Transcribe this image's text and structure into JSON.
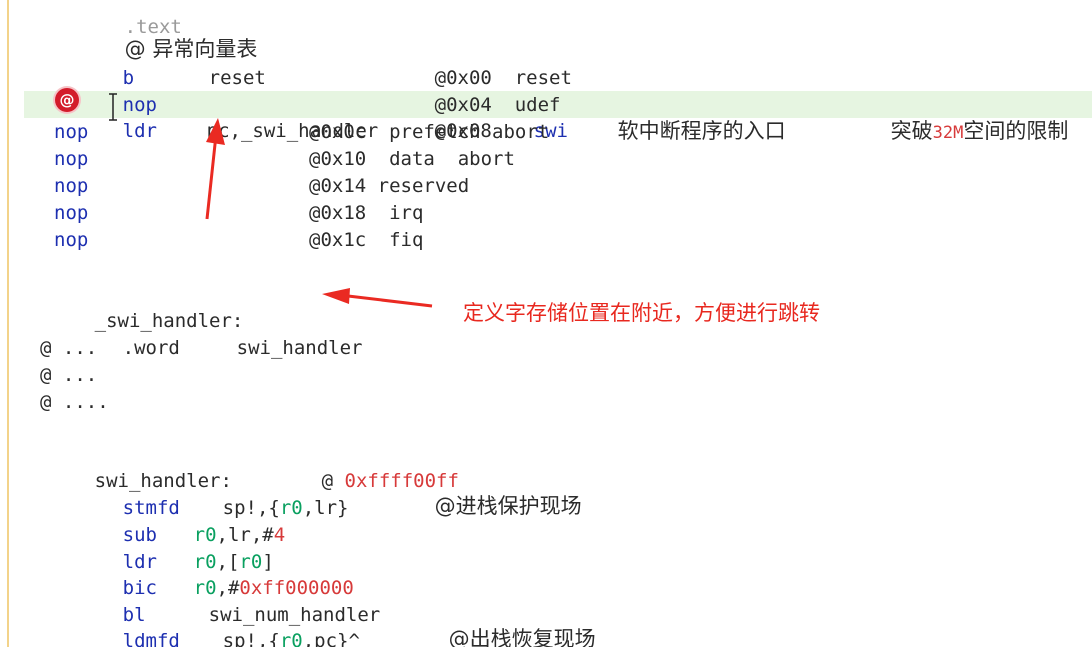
{
  "lines": {
    "text_directive": ".text",
    "vector_comment": "@ 异常向量表",
    "l_b": {
      "op": "b",
      "arg": "reset",
      "comment": "@0x00  reset"
    },
    "l_nop_udef": {
      "op": "nop",
      "comment": "@0x04  udef"
    },
    "l_ldr": {
      "op": "ldr",
      "arg": "pc,_swi_handler",
      "comment_addr": "@0x08",
      "comment_swi": "swi",
      "desc_cn": "软中断程序的入口",
      "desc_break": "突破",
      "desc_32m": "32M",
      "desc_rest": "空间的限制"
    },
    "l_nop_prefetch": {
      "op": "nop",
      "comment": "@0x0c  prefetch abort"
    },
    "l_nop_data": {
      "op": "nop",
      "comment": "@0x10  data  abort"
    },
    "l_nop_reserved": {
      "op": "nop",
      "comment": "@0x14 reserved"
    },
    "l_nop_irq": {
      "op": "nop",
      "comment": "@0x18  irq"
    },
    "l_nop_fiq": {
      "op": "nop",
      "comment": "@0x1c  fiq"
    },
    "swi_label": "_swi_handler:",
    "word_line": {
      "op": ".word",
      "arg": "swi_handler"
    },
    "dots1": "@ ...",
    "dots2": "@ ...",
    "dots3": "@ ....",
    "handler_label": "swi_handler:",
    "handler_comment_at": "@",
    "handler_comment_num": "0xffff00ff",
    "stmfd": {
      "op": "stmfd",
      "p1": "sp!,{",
      "reg": "r0",
      "p2": ",lr}",
      "comment": "@进栈保护现场"
    },
    "sub": {
      "op": "sub",
      "reg": "r0",
      "p1": ",lr,#",
      "num": "4"
    },
    "ldr2": {
      "op": "ldr",
      "reg1": "r0",
      "p1": ",[",
      "reg2": "r0",
      "p2": "]"
    },
    "bic": {
      "op": "bic",
      "reg": "r0",
      "p1": ",#",
      "num": "0xff000000"
    },
    "bl": {
      "op": "bl",
      "arg": "swi_num_handler"
    },
    "ldmfd": {
      "op": "ldmfd",
      "p1": "sp!,{",
      "reg": "r0",
      "p2": ",pc}^",
      "comment": "@出栈恢复现场"
    }
  },
  "annotation": "定义字存储位置在附近，方便进行跳转",
  "breakpoint_glyph": "@",
  "colors": {
    "keyword": "#1d2fb0",
    "register": "#0aa060",
    "number": "#d73a3a",
    "annotation": "#e8281f",
    "highlight_row": "#e6f5e1"
  },
  "icons": [
    "breakpoint-icon",
    "text-cursor-icon",
    "arrow-up-icon",
    "arrow-left-icon"
  ]
}
